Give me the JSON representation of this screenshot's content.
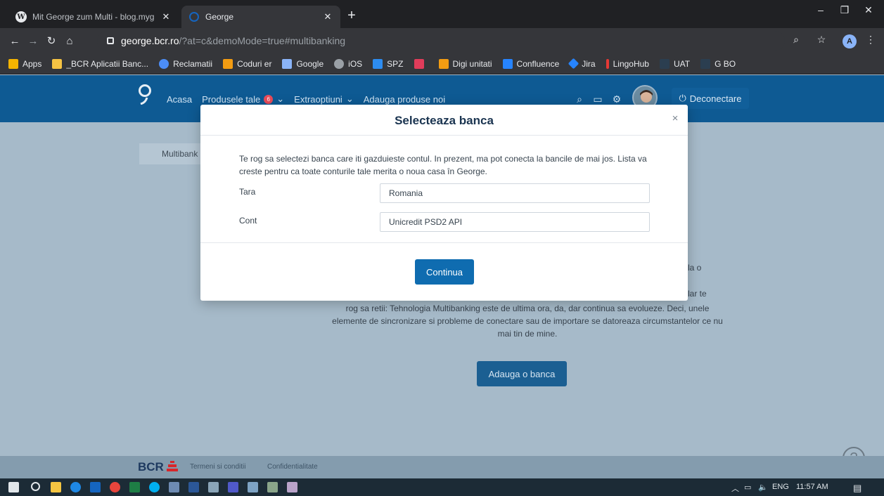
{
  "browser": {
    "tabs": [
      {
        "title": "Mit George zum Multi - blog.myg",
        "icon": "wordpress-icon"
      },
      {
        "title": "George",
        "icon": "george-icon"
      }
    ],
    "url_host": "george.bcr.ro",
    "url_path": "/?at=c&demoMode=true#multibanking",
    "profile_initial": "A",
    "bookmarks": [
      {
        "label": "Apps",
        "color": "#f4b400"
      },
      {
        "label": "_BCR Aplicatii Banc...",
        "color": "#f6c343"
      },
      {
        "label": "Reclamatii",
        "color": "#4c8df6"
      },
      {
        "label": "Coduri er",
        "color": "#f39c12"
      },
      {
        "label": "Google",
        "color": "#8ab4f8"
      },
      {
        "label": "iOS",
        "color": "#9aa0a6"
      },
      {
        "label": "SPZ",
        "color": "#2d8cf0"
      },
      {
        "label": "",
        "color": "#e03c5a"
      },
      {
        "label": "Digi unitati",
        "color": "#f39c12"
      },
      {
        "label": "Confluence",
        "color": "#2684ff"
      },
      {
        "label": "Jira",
        "color": "#2684ff"
      },
      {
        "label": "LingoHub",
        "color": "#e53935"
      },
      {
        "label": "UAT",
        "color": "#35363a"
      },
      {
        "label": "G BO",
        "color": "#35363a"
      }
    ]
  },
  "header": {
    "nav": {
      "home": "Acasa",
      "products": "Produsele tale",
      "products_badge": "6",
      "extras": "Extraoptiuni",
      "add_products": "Adauga produse noi"
    },
    "logout": "Deconectare"
  },
  "page": {
    "tab_label": "Multibank",
    "frag_right_1": "la o",
    "frag_right_2": "lar te",
    "body_text": "rog sa retii: Tehnologia Multibanking este de ultima ora, da, dar continua sa evolueze. Deci, unele elemente de sincronizare si probleme de conectare sau de importare se datoreaza circumstantelor ce nu mai tin de mine.",
    "add_bank": "Adauga o banca",
    "help": "?"
  },
  "footer": {
    "brand": "BCR",
    "terms": "Termeni si conditii",
    "privacy": "Confidentialitate"
  },
  "modal": {
    "title": "Selecteaza banca",
    "close": "×",
    "description": "Te rog sa selectezi banca care iti gazduieste contul. In prezent, ma pot conecta la bancile de mai jos. Lista va creste pentru ca toate conturile tale merita o noua casa în George.",
    "country_label": "Tara",
    "country_value": "Romania",
    "account_label": "Cont",
    "account_value": "Unicredit PSD2 API",
    "continue": "Continua"
  },
  "taskbar": {
    "language": "ENG",
    "time": "11:57 AM"
  }
}
